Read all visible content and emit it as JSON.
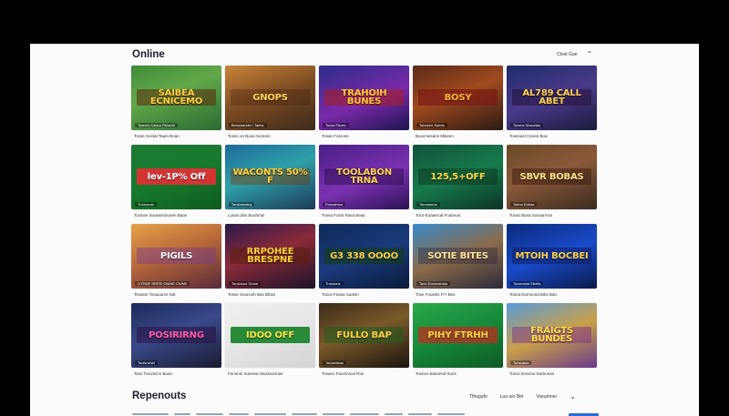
{
  "sections": {
    "online_title": "Online",
    "online_filter_label": "Ctost Gan",
    "reps_title": "Repenouts",
    "reps_filters": [
      "Tfhugufo",
      "Lua ser Bet",
      "Voeamner"
    ]
  },
  "games": [
    {
      "banner": "SAIBEA ECNICEMO",
      "tag": "Toanon Cactur Rnlanbl",
      "caption": "Tosse Sostat Taam Boan",
      "bg": "linear-gradient(160deg,#3f8a3a 0%,#62a84a 40%,#2b6a33 100%)",
      "banner_color": "#ffcf3f",
      "banner_bg": "rgba(90,40,10,0.55)"
    },
    {
      "banner": "GNOPS",
      "tag": "Benwsarsfio l Tanhs",
      "caption": "Tossn on Buoa Sonnen",
      "bg": "linear-gradient(160deg,#c9843a 0%,#7a4a22 50%,#3b2a1c 100%)",
      "banner_color": "#ffd45a",
      "banner_bg": "rgba(60,30,10,0.3)"
    },
    {
      "banner": "TRAHOIH BUNES",
      "tag": "Tocse Fhuec",
      "caption": "Tosan Fosrons",
      "bg": "linear-gradient(160deg,#2a2d8a 0%,#7a2aa8 55%,#1c1650 100%)",
      "banner_color": "#ffcc33",
      "banner_bg": "rgba(170,30,30,0.55)"
    },
    {
      "banner": "BOSY",
      "tag": "Tonnsen Sumts",
      "caption": "Buocmesans Mlasnn",
      "bg": "linear-gradient(160deg,#5a2a18 0%,#a04a1f 45%,#2a1a14 100%)",
      "banner_color": "#ffb23a",
      "banner_bg": "rgba(120,20,20,0.6)"
    },
    {
      "banner": "AL789 CALL ABET",
      "tag": "Tocsns Sbsnvtas",
      "caption": "Tosenact Ceven Boa",
      "bg": "linear-gradient(160deg,#1f2c6a 0%,#4a3a8a 50%,#1a1a3a 100%)",
      "banner_color": "#ffd24a",
      "banner_bg": "rgba(30,10,40,0.45)"
    },
    {
      "banner": "lev-1P% Off",
      "tag": "Tronuonis",
      "caption": "Tocluse Suuwsnonoren Baas",
      "bg": "linear-gradient(160deg,#1e7a35 0%,#167a2c 50%,#0f5a20 100%)",
      "banner_color": "#ffffff",
      "banner_bg": "#d23434"
    },
    {
      "banner": "WACONTS 50% F",
      "tag": "Tonsnnostuy",
      "caption": "Losas dsis Buohmts",
      "bg": "linear-gradient(160deg,#1d6a9a 0%,#2fa0a8 45%,#1c3a5a 100%)",
      "banner_color": "#ffcf3a",
      "banner_bg": "rgba(120,60,10,0.45)"
    },
    {
      "banner": "TOOLABON TRNA",
      "tag": "Fonoamoo",
      "caption": "Tosea Fosst Rasa Beas",
      "bg": "linear-gradient(160deg,#4a1f86 0%,#7a32b0 55%,#2a1254 100%)",
      "banner_color": "#ffd24a",
      "banner_bg": "rgba(40,10,70,0.45)"
    },
    {
      "banner": "125,5+OFF",
      "tag": "Tornnsmos",
      "caption": "Tocs-Eoawncal Fnutreos",
      "bg": "linear-gradient(160deg,#10533a 0%,#177a4c 50%,#0c3324 100%)",
      "banner_color": "#ffd84a",
      "banner_bg": "rgba(10,40,20,0.4)"
    },
    {
      "banner": "SBVR BOBAS",
      "tag": "Tobno Enbas",
      "caption": "Tosao Basa Sossarmos",
      "bg": "linear-gradient(160deg,#6a4a2a 0%,#8a5a3a 45%,#3a2a20 100%)",
      "banner_color": "#ffe08a",
      "banner_bg": "rgba(50,20,10,0.45)"
    },
    {
      "banner": "PIGILS",
      "tag": "LITRDE SRFIE ONINE CWNE",
      "caption": "Tesasm Tosauunrs Sat",
      "bg": "linear-gradient(160deg,#e6a24a 0%,#b8683a 45%,#5a2a3a 100%)",
      "banner_color": "#f2f6ff",
      "banner_bg": "rgba(120,60,140,0.45)"
    },
    {
      "banner": "RRPOHEE BRESPNE",
      "tag": "Tonsnuoo Tonne",
      "caption": "Tosse Sounceh Bas Bfass",
      "bg": "linear-gradient(160deg,#2a1a4a 0%,#8a2a3a 45%,#1a1428 100%)",
      "banner_color": "#ffd03a",
      "banner_bg": "rgba(90,30,10,0.55)"
    },
    {
      "banner": "G3 338 OOOO",
      "tag": "Tronsons",
      "caption": "Tosos Fnasa Suasm",
      "bg": "linear-gradient(160deg,#0f2a5a 0%,#1a3a7a 50%,#0a1a3a 100%)",
      "banner_color": "#ffd24a",
      "banner_bg": "rgba(20,60,20,0.6)"
    },
    {
      "banner": "SOTIE BITES",
      "tag": "Tonn Eonnosmau",
      "caption": "Tose Fouesls Fr'r Bes",
      "bg": "linear-gradient(160deg,#3a8ac8 0%,#8a6a4a 50%,#2a2a3a 100%)",
      "banner_color": "#ffe4a0",
      "banner_bg": "rgba(30,30,60,0.35)"
    },
    {
      "banner": "MTOIH BOCBEI",
      "tag": "Tocsnonst Sbotts",
      "caption": "Tosnd Earnnond Bibs Ban",
      "bg": "linear-gradient(160deg,#0a2a7a 0%,#1a4ac8 50%,#0a1a4a 100%)",
      "banner_color": "#ffd24a",
      "banner_bg": "rgba(10,20,80,0.45)"
    },
    {
      "banner": "POSIRIRNG",
      "tag": "Tonlvnshel",
      "caption": "Tass Turuntd is Buan",
      "bg": "linear-gradient(160deg,#1a2a5a 0%,#3a4a8a 45%,#1a1a30 100%)",
      "banner_color": "#ff5aa8",
      "banner_bg": "rgba(40,10,60,0.5)"
    },
    {
      "banner": "IDOO OFF",
      "tag": "",
      "caption": "Fenonin Susseso Bussssrmas",
      "bg": "linear-gradient(160deg,#f0f0f0 0%,#e6e6e6 50%,#d4d4d4 100%)",
      "banner_color": "#ffe64a",
      "banner_bg": "#2a8a3a"
    },
    {
      "banner": "FULLO BAP",
      "tag": "Tonoenlssu",
      "caption": "Tosaeo Faursnsod Rus",
      "bg": "linear-gradient(160deg,#3a2a1a 0%,#7a5a2a 45%,#1a1410 100%)",
      "banner_color": "#ffd24a",
      "banner_bg": "rgba(40,90,30,0.6)"
    },
    {
      "banner": "PIHY FTRHH",
      "tag": "",
      "caption": "Tosnoo Easnesd Suns",
      "bg": "linear-gradient(160deg,#2aa84a 0%,#16883a 50%,#0e5a24 100%)",
      "banner_color": "#ffd24a",
      "banner_bg": "rgba(200,40,30,0.7)"
    },
    {
      "banner": "FRAIGTS BUNDES",
      "tag": "Tonsuaoo",
      "caption": "Tosoc Eosreor Eamunas",
      "bg": "linear-gradient(160deg,#5a9ad8 0%,#c8a04a 50%,#6a3a8a 100%)",
      "banner_color": "#ffe04a",
      "banner_bg": "rgba(120,40,140,0.45)"
    }
  ]
}
